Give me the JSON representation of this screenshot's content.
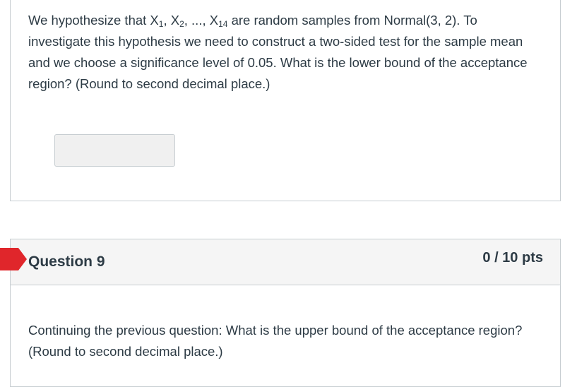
{
  "question8": {
    "text_part1": "We hypothesize that X",
    "sub1": "1",
    "sep1": ", X",
    "sub2": "2",
    "sep2": ", ..., X",
    "sub3": "14",
    "text_part2": " are random samples from Normal(3, 2). To investigate this hypothesis we need to construct a two-sided test for the sample mean and we choose a significance level of 0.05. What is the lower bound of the acceptance region? (Round to second decimal place.)",
    "answer_value": ""
  },
  "question9": {
    "title": "Question 9",
    "points": "0 / 10 pts",
    "text": "Continuing the previous question: What is the upper bound of the acceptance region? (Round to second decimal place.)",
    "status_color": "#e0262b"
  }
}
